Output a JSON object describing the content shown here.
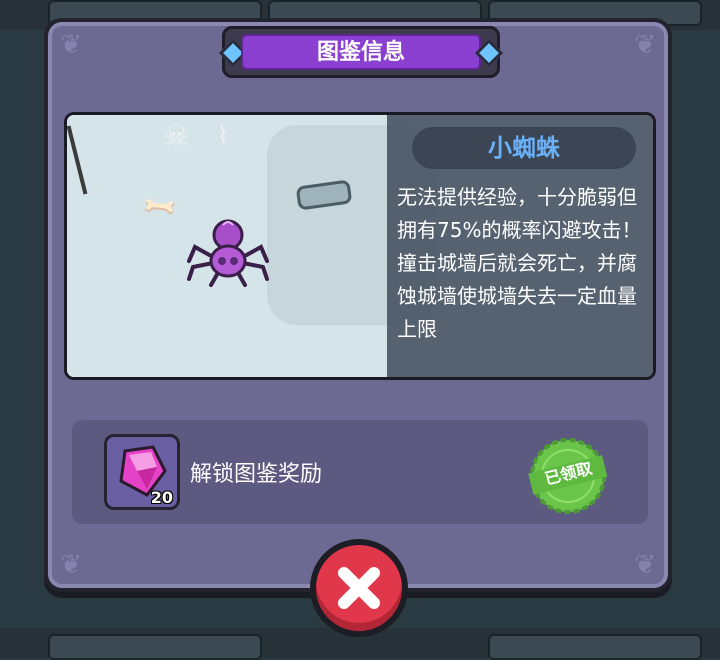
{
  "dialog": {
    "title": "图鉴信息"
  },
  "creature": {
    "name": "小蜘蛛",
    "description": "无法提供经验，十分脆弱但拥有75%的概率闪避攻击！撞击城墙后就会死亡，并腐蚀城墙使城墙失去一定血量上限"
  },
  "reward": {
    "label": "解锁图鉴奖励",
    "item_icon": "pink-gem-icon",
    "count": "20",
    "status": "已领取"
  },
  "close_button": {
    "icon": "close-x-icon"
  },
  "colors": {
    "panel": "#6c6a93",
    "title_accent": "#8a3fd0",
    "name_text": "#6ab0f6",
    "close_button": "#e0384a",
    "claimed_stamp": "#6ac54a"
  }
}
